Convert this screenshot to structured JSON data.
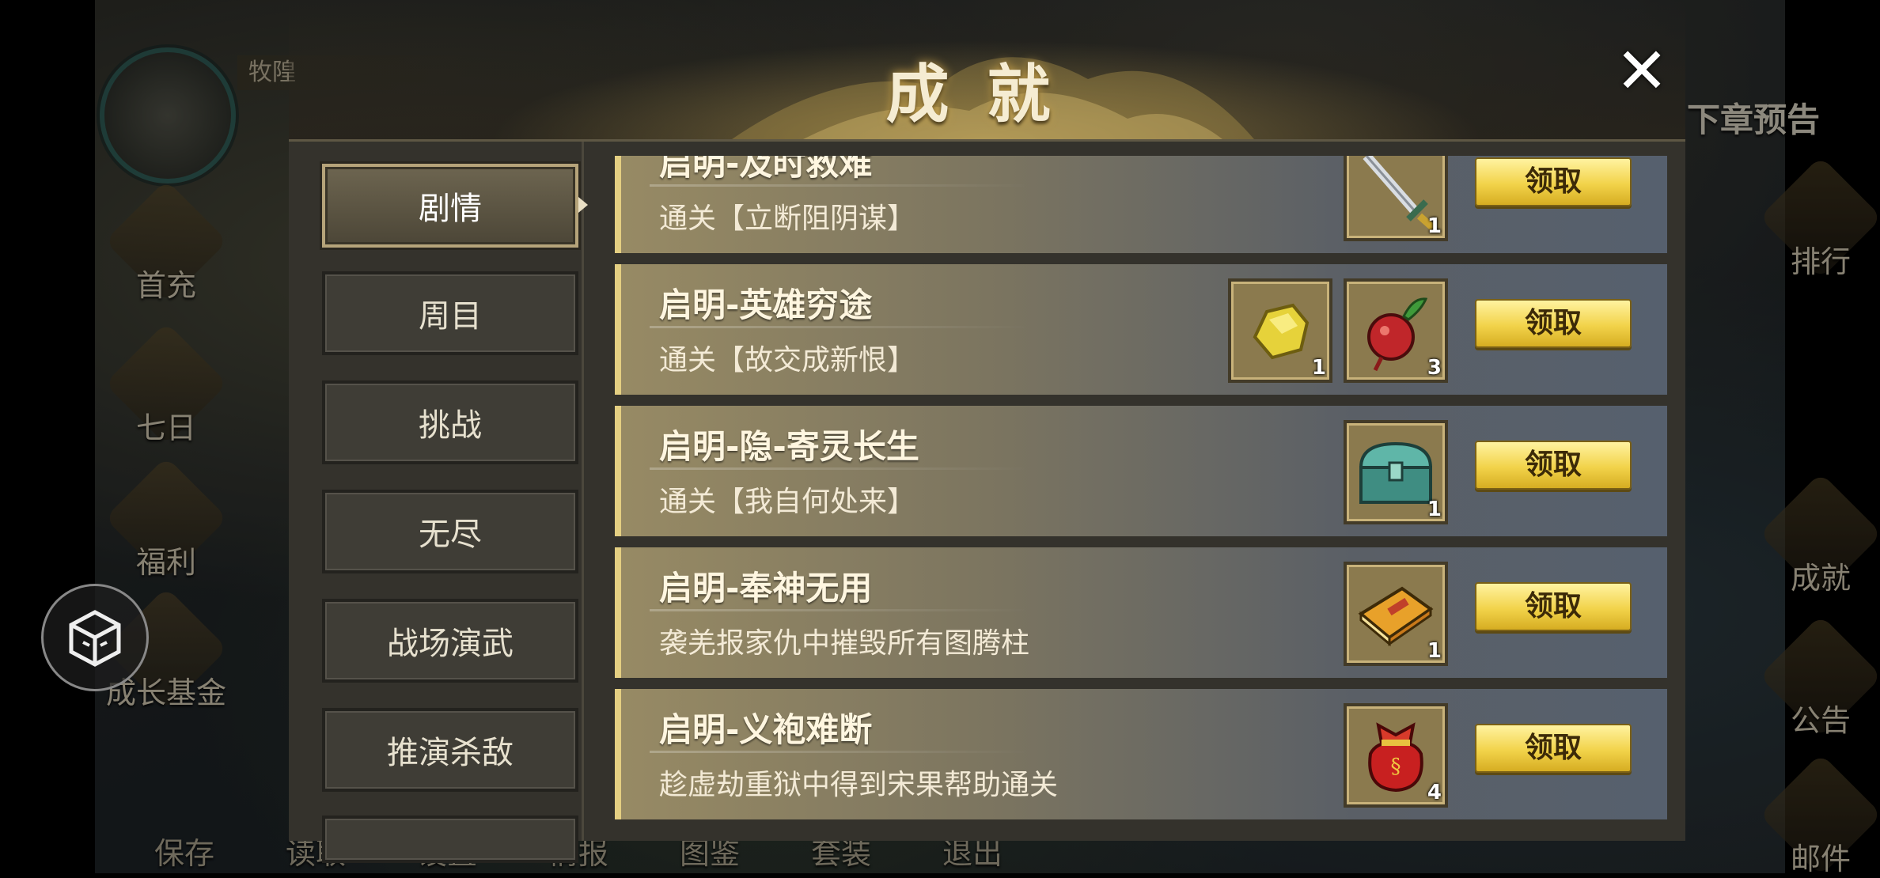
{
  "background": {
    "player_name": "牧隍",
    "next_chapter": "下章预告",
    "left_menu": [
      {
        "label": "首充",
        "icon": "gift-bag-icon"
      },
      {
        "label": "七日",
        "icon": "scroll-icon"
      },
      {
        "label": "福利",
        "icon": "gift-box-icon"
      },
      {
        "label": "成长基金",
        "icon": "gold-coins-icon"
      }
    ],
    "right_menu": [
      {
        "label": "排行",
        "icon": "ranking-tower-icon"
      },
      {
        "label": "成就",
        "icon": "jade-dragon-icon"
      },
      {
        "label": "公告",
        "icon": "horn-icon"
      },
      {
        "label": "邮件",
        "icon": "mail-icon"
      }
    ],
    "bottom_menu": [
      "保存",
      "读取",
      "设置",
      "情报",
      "图鉴",
      "套装",
      "退出"
    ]
  },
  "modal": {
    "title": "成就",
    "close_icon": "close-icon",
    "categories": [
      "剧情",
      "周目",
      "挑战",
      "无尽",
      "战场演武",
      "推演杀敌"
    ],
    "active_category": "剧情",
    "achievements": [
      {
        "title": "启明-及时救难",
        "desc": "通关【立断阻阴谋】",
        "rewards": [
          {
            "icon": "sword-icon",
            "count": "1"
          }
        ],
        "button": "领取"
      },
      {
        "title": "启明-英雄穷途",
        "desc": "通关【故交成新恨】",
        "rewards": [
          {
            "icon": "gold-nugget-icon",
            "count": "1"
          },
          {
            "icon": "red-radish-icon",
            "count": "3"
          }
        ],
        "button": "领取"
      },
      {
        "title": "启明-隐-寄灵长生",
        "desc": "通关【我自何处来】",
        "rewards": [
          {
            "icon": "jade-chest-icon",
            "count": "1"
          }
        ],
        "button": "领取"
      },
      {
        "title": "启明-奉神无用",
        "desc": "袭羌报家仇中摧毁所有图腾柱",
        "rewards": [
          {
            "icon": "book-icon",
            "count": "1"
          }
        ],
        "button": "领取"
      },
      {
        "title": "启明-义袍难断",
        "desc": "趁虚劫重狱中得到宋果帮助通关",
        "rewards": [
          {
            "icon": "red-pouch-icon",
            "count": "4"
          }
        ],
        "button": "领取"
      }
    ]
  },
  "colors": {
    "accent_gold": "#e4cf82",
    "claim_button": "#f2d34a",
    "row_left": "#978a64",
    "row_right": "#56606e"
  }
}
